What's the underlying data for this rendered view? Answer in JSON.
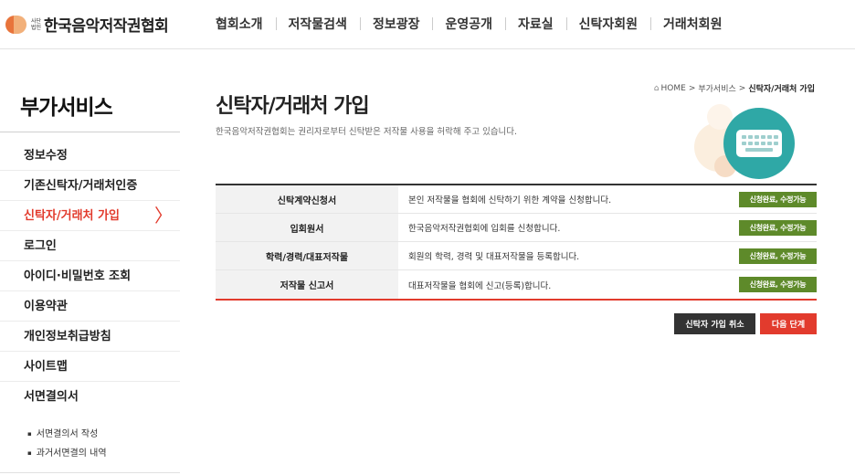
{
  "header": {
    "logo_small_top": "사단",
    "logo_small_bottom": "법인",
    "logo_text": "한국음악저작권협회",
    "nav": [
      "협회소개",
      "저작물검색",
      "정보광장",
      "운영공개",
      "자료실",
      "신탁자회원",
      "거래처회원"
    ]
  },
  "sidebar": {
    "title": "부가서비스",
    "items": [
      {
        "label": "정보수정"
      },
      {
        "label": "기존신탁자/거래처인증"
      },
      {
        "label": "신탁자/거래처 가입",
        "active": true
      },
      {
        "label": "로그인"
      },
      {
        "label": "아이디·비밀번호 조회"
      },
      {
        "label": "이용약관"
      },
      {
        "label": "개인정보취급방침"
      },
      {
        "label": "사이트맵"
      },
      {
        "label": "서면결의서"
      }
    ],
    "active_chevron": "〉",
    "sub_items": [
      "서면결의서 작성",
      "과거서면결의 내역"
    ]
  },
  "main": {
    "title": "신탁자/거래처 가입",
    "description": "한국음악저작권협회는 권리자로부터 신탁받은 저작물 사용을 허락해 주고 있습니다.",
    "breadcrumb": {
      "home": "HOME",
      "sep": ">",
      "parent": "부가서비스",
      "current": "신탁자/거래처 가입"
    },
    "table": [
      {
        "title": "신탁계약신청서",
        "desc": "본인 저작물을 협회에 신탁하기 위한 계약을 신청합니다.",
        "status": "신청완료, 수정가능"
      },
      {
        "title": "입회원서",
        "desc": "한국음악저작권협회에 입회를 신청합니다.",
        "status": "신청완료, 수정가능"
      },
      {
        "title": "학력/경력/대표저작물",
        "desc": "회원의 학력, 경력 및 대표저작물을 등록합니다.",
        "status": "신청완료, 수정가능"
      },
      {
        "title": "저작물 신고서",
        "desc": "대표저작물을 협회에 신고(등록)합니다.",
        "status": "신청완료, 수정가능"
      }
    ],
    "buttons": {
      "cancel": "신탁자 가입 취소",
      "next": "다음 단계"
    }
  },
  "colors": {
    "accent": "#e23b2d",
    "badge": "#5e8a2a",
    "teal": "#2fa8a6"
  },
  "icons": [
    "home-icon",
    "keyboard-icon",
    "chevron-right-icon",
    "logo-icon"
  ]
}
